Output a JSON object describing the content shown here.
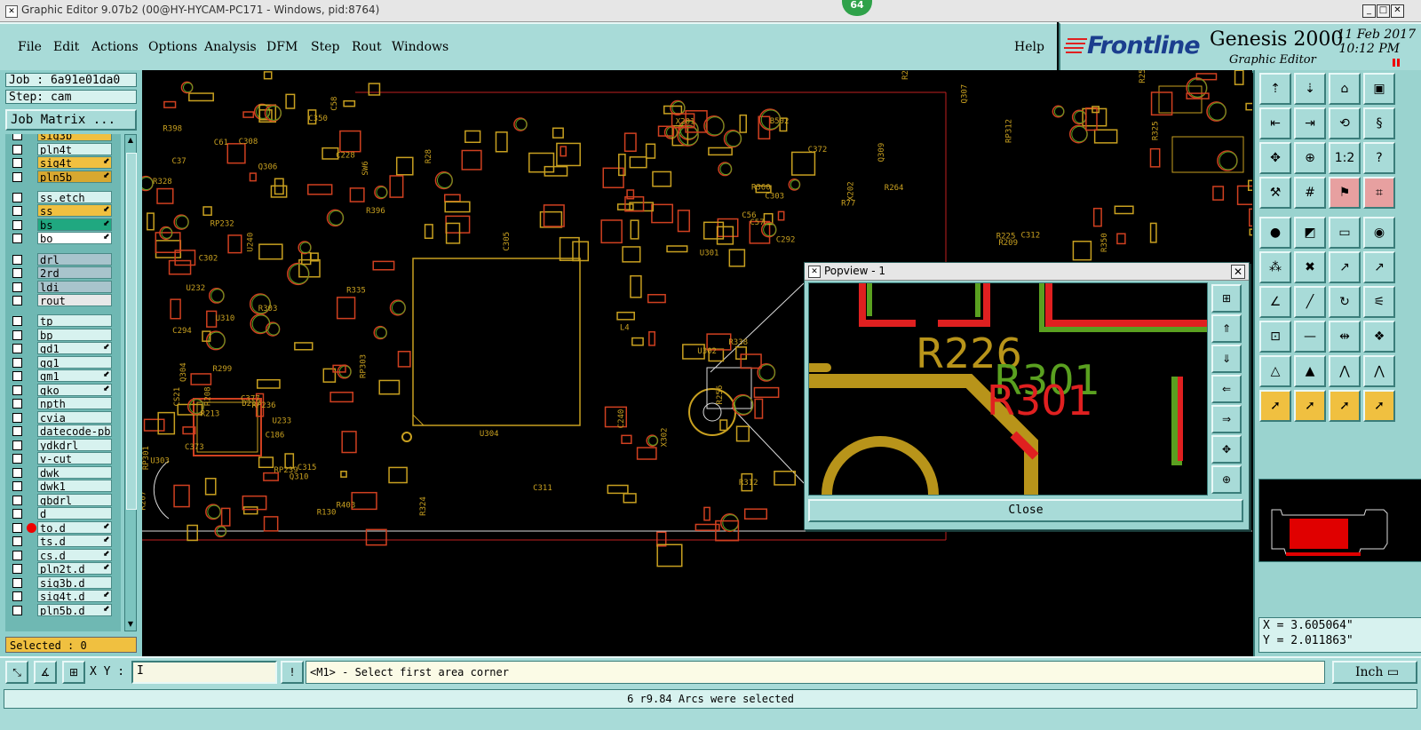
{
  "window": {
    "title": "Graphic Editor 9.07b2 (00@HY-HYCAM-PC171 - Windows, pid:8764)",
    "badge": "64"
  },
  "menu": [
    "File",
    "Edit",
    "Actions",
    "Options",
    "Analysis",
    "DFM",
    "Step",
    "Rout",
    "Windows"
  ],
  "help_label": "Help",
  "logo": {
    "brand": "Frontline",
    "product": "Genesis 2000",
    "subtitle": "Graphic Editor",
    "date": "11 Feb 2017",
    "time": "10:12 PM"
  },
  "job": "Job : 6a91e01da0",
  "step": "Step: cam",
  "job_matrix_label": "Job Matrix ...",
  "layers": [
    {
      "name": "sig3b",
      "color": "#f0c040",
      "arrow": false
    },
    {
      "name": "pln4t",
      "color": "#d7f2ef",
      "arrow": false
    },
    {
      "name": "sig4t",
      "color": "#f0c040",
      "arrow": true
    },
    {
      "name": "pln5b",
      "color": "#d8a830",
      "arrow": true
    },
    {
      "name": "ss.etch",
      "color": "#d7f2ef",
      "arrow": false
    },
    {
      "name": "ss",
      "color": "#f0c040",
      "arrow": true
    },
    {
      "name": "bs",
      "color": "#20a880",
      "arrow": true
    },
    {
      "name": "bo",
      "color": "#ffffff",
      "arrow": true
    },
    {
      "name": "drl",
      "color": "#a8c4cc",
      "arrow": false
    },
    {
      "name": "2rd",
      "color": "#a8c4cc",
      "arrow": false
    },
    {
      "name": "ldi",
      "color": "#a8c4cc",
      "arrow": false
    },
    {
      "name": "rout",
      "color": "#e8e8e8",
      "arrow": false
    },
    {
      "name": "tp",
      "color": "#d7f2ef",
      "arrow": false
    },
    {
      "name": "bp",
      "color": "#d7f2ef",
      "arrow": false
    },
    {
      "name": "gd1",
      "color": "#d7f2ef",
      "arrow": true
    },
    {
      "name": "gg1",
      "color": "#d7f2ef",
      "arrow": false
    },
    {
      "name": "gm1",
      "color": "#d7f2ef",
      "arrow": true
    },
    {
      "name": "gko",
      "color": "#d7f2ef",
      "arrow": true
    },
    {
      "name": "npth",
      "color": "#d7f2ef",
      "arrow": false
    },
    {
      "name": "cvia",
      "color": "#d7f2ef",
      "arrow": false
    },
    {
      "name": "datecode-pb",
      "color": "#d7f2ef",
      "arrow": false
    },
    {
      "name": "ydkdrl",
      "color": "#d7f2ef",
      "arrow": false
    },
    {
      "name": "v-cut",
      "color": "#d7f2ef",
      "arrow": false
    },
    {
      "name": "dwk",
      "color": "#d7f2ef",
      "arrow": false
    },
    {
      "name": "dwk1",
      "color": "#d7f2ef",
      "arrow": false
    },
    {
      "name": "gbdrl",
      "color": "#d7f2ef",
      "arrow": false
    },
    {
      "name": "d",
      "color": "#d7f2ef",
      "arrow": false
    },
    {
      "name": "to.d",
      "color": "#d7f2ef",
      "arrow": true,
      "dot": true
    },
    {
      "name": "ts.d",
      "color": "#d7f2ef",
      "arrow": true
    },
    {
      "name": "cs.d",
      "color": "#d7f2ef",
      "arrow": true
    },
    {
      "name": "pln2t.d",
      "color": "#d7f2ef",
      "arrow": true
    },
    {
      "name": "sig3b.d",
      "color": "#d7f2ef",
      "arrow": false
    },
    {
      "name": "sig4t.d",
      "color": "#d7f2ef",
      "arrow": true
    },
    {
      "name": "pln5b.d",
      "color": "#d7f2ef",
      "arrow": true
    }
  ],
  "selected": "Selected : 0",
  "popview": {
    "title": "Popview - 1",
    "close_label": "Close",
    "labels": [
      "R226",
      "R301",
      "R301"
    ]
  },
  "coords": {
    "x": "X = 3.605064\"",
    "y": "Y = 2.011863\""
  },
  "xy_label": "X Y :",
  "prompt": "<M1> - Select first area corner",
  "unit": "Inch",
  "status": "6 r9.84 Arcs were selected",
  "board_labels": [
    "RP239",
    "C302",
    "RP236",
    "RP232",
    "C308",
    "X201",
    "U302",
    "U301",
    "RP303",
    "U303",
    "C305",
    "R328",
    "R303",
    "U233",
    "R312",
    "C312",
    "R335",
    "RP312",
    "R325",
    "RP301",
    "C240",
    "X202",
    "R213",
    "R299",
    "U240",
    "C292",
    "R253",
    "R256",
    "R264",
    "C37",
    "C58",
    "C56",
    "C57",
    "C61",
    "L4",
    "R77",
    "C377",
    "R396",
    "C350",
    "R398",
    "U304",
    "R403",
    "C372",
    "C373",
    "R350",
    "R360",
    "X302",
    "U310",
    "Q310",
    "R130",
    "Q306",
    "Q307",
    "Q304",
    "Q309",
    "R315",
    "C315",
    "R338",
    "R208",
    "R209",
    "R207",
    "C303",
    "C311",
    "R225",
    "R324",
    "SW6",
    "U232",
    "C228",
    "CS21",
    "C294",
    "B502",
    "D217",
    "1V",
    "R22",
    "R28",
    "C186"
  ]
}
